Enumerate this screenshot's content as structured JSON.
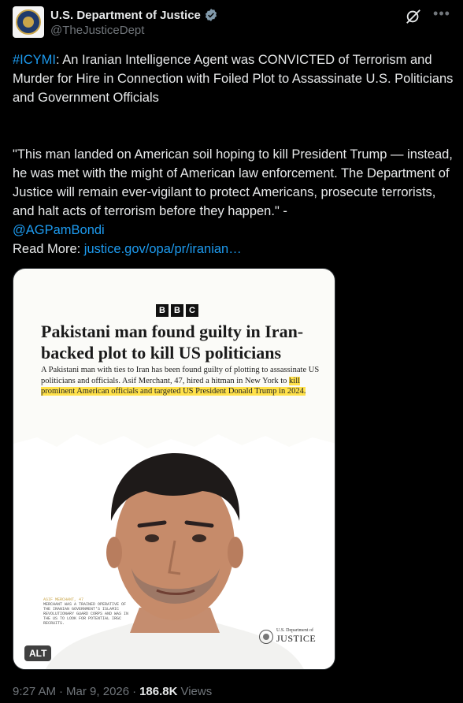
{
  "account": {
    "display_name": "U.S. Department of Justice",
    "handle": "@TheJusticeDept"
  },
  "tweet": {
    "hashtag": "#ICYMI",
    "line1_rest": ": An Iranian Intelligence Agent was CONVICTED of Terrorism and Murder for Hire in Connection with Foiled Plot to Assassinate U.S. Politicians and Government Officials",
    "quote": "\"This man landed on American soil hoping to kill President Trump — instead, he was met with the might of American law enforcement. The Department of Justice will remain ever-vigilant to protect Americans, prosecute terrorists, and halt acts of terrorism before they happen.\" -",
    "mention": "@AGPamBondi",
    "read_more_label": "Read More: ",
    "link_text": "justice.gov/opa/pr/iranian…"
  },
  "media": {
    "bbc_letters": [
      "B",
      "B",
      "C"
    ],
    "headline": "Pakistani man found guilty in Iran-backed plot to kill US politicians",
    "subtext_plain": "A Pakistani man with ties to Iran has been found guilty of plotting to assassinate US politicians and officials. Asif Merchant, 47, hired a hitman in New York to ",
    "subtext_highlight": "kill prominent American officials and targeted US President Donald Trump in 2024.",
    "caption_name": "ASIF MERCHANT, 47",
    "caption_text": "MERCHANT WAS A TRAINED OPERATIVE OF THE IRANIAN GOVERNMENT'S ISLAMIC REVOLUTIONARY GUARD CORPS AND WAS IN THE US TO LOOK FOR POTENTIAL IRGC RECRUITS.",
    "doj_small": "U.S. Department of",
    "doj_big": "JUSTICE",
    "alt_label": "ALT"
  },
  "footer": {
    "time": "9:27 AM",
    "sep1": "·",
    "date": "Mar 9, 2026",
    "sep2": "·",
    "views_count": "186.8K",
    "views_label": "Views"
  },
  "colors": {
    "background": "#000000",
    "link": "#1d9bf0",
    "verified": "#829aab",
    "highlight": "#ffe14a"
  },
  "icons": {
    "verified": "verified-badge-icon",
    "grok": "grok-icon",
    "more": "more-options-icon"
  }
}
